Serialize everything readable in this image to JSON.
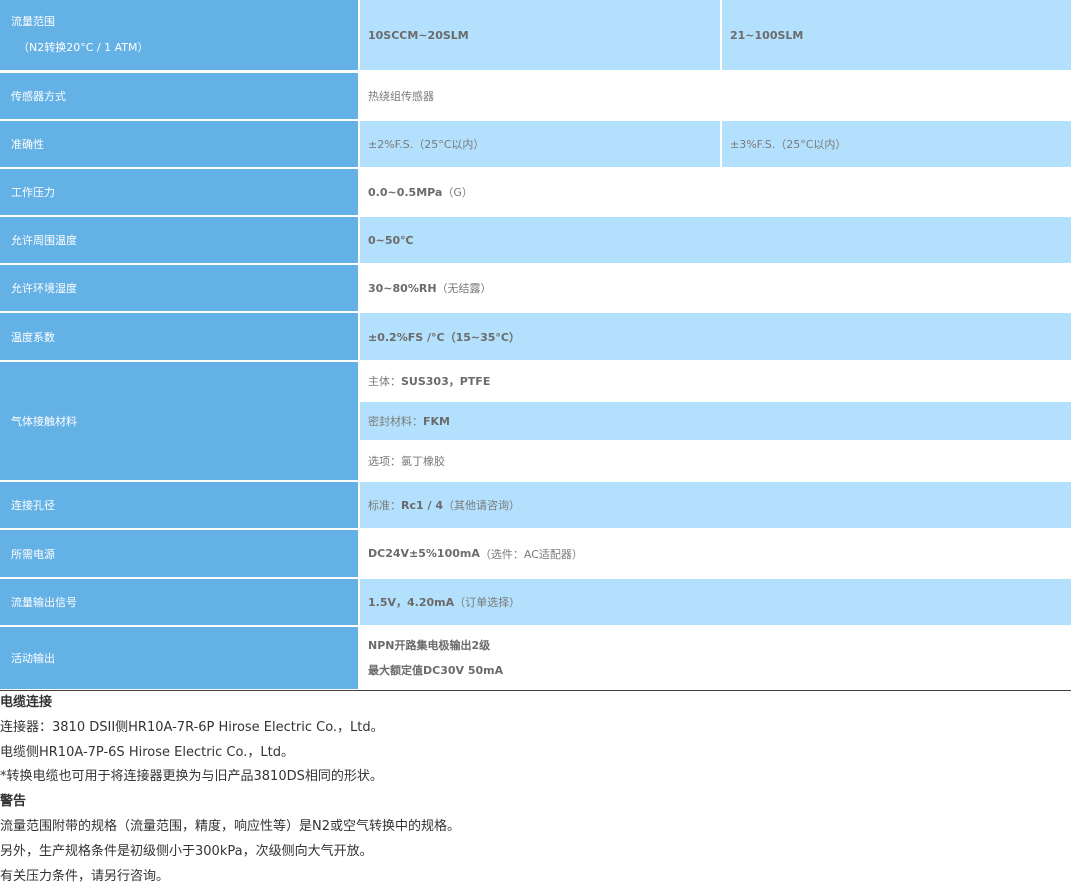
{
  "table": {
    "flow_range": {
      "label_line1": "流量范围",
      "label_line2": "（N2转换20°C / 1 ATM）",
      "value_a": "10SCCM~20SLM",
      "value_b": "21~100SLM"
    },
    "sensor_type": {
      "label": "传感器方式",
      "value": "热绕组传感器"
    },
    "accuracy": {
      "label": "准确性",
      "value_a": "±2%F.S.（25°C以内）",
      "value_b": "±3%F.S.（25°C以内）"
    },
    "working_pressure": {
      "label": "工作压力",
      "value_main": "0.0~0.5MPa",
      "value_suffix": "（G）"
    },
    "ambient_temperature": {
      "label": "允许周围温度",
      "value": "0~50℃"
    },
    "ambient_humidity": {
      "label": "允许环境湿度",
      "value_main": "30~80%RH",
      "value_suffix": "（无结露）"
    },
    "temperature_coefficient": {
      "label": "温度系数",
      "value": "±0.2%FS /°C（15~35°C）"
    },
    "wetted_materials": {
      "label": "气体接触材料",
      "body_prefix": "主体：",
      "body_value": "SUS303，PTFE",
      "seal_prefix": "密封材料：",
      "seal_value": "FKM",
      "option_text": "选项：氯丁橡胶"
    },
    "port_size": {
      "label": "连接孔径",
      "prefix": "标准：",
      "value": "Rc1 / 4",
      "suffix": "（其他请咨询）"
    },
    "power_supply": {
      "label": "所需电源",
      "value_main": "DC24V±5%100mA",
      "value_suffix": "（选件：AC适配器）"
    },
    "flow_output": {
      "label": "流量输出信号",
      "value_main": "1.5V，4.20mA",
      "value_suffix": "（订单选择）"
    },
    "alarm_output": {
      "label": "活动输出",
      "line1": "NPN开路集电极输出2级",
      "line2": "最大额定值DC30V 50mA"
    }
  },
  "notes": {
    "cable_heading": "电缆连接",
    "connector_line": "连接器：3810 DSII侧HR10A-7R-6P Hirose Electric Co.，Ltd。",
    "cable_line": "电缆侧HR10A-7P-6S Hirose Electric Co.，Ltd。",
    "conversion_line": "*转换电缆也可用于将连接器更换为与旧产品3810DS相同的形状。",
    "warning_heading": "警告",
    "warning_line1": "流量范围附带的规格（流量范围，精度，响应性等）是N2或空气转换中的规格。",
    "warning_line2": "另外，生产规格条件是初级侧小于300kPa，次级侧向大气开放。",
    "warning_line3": "有关压力条件，请另行咨询。"
  }
}
